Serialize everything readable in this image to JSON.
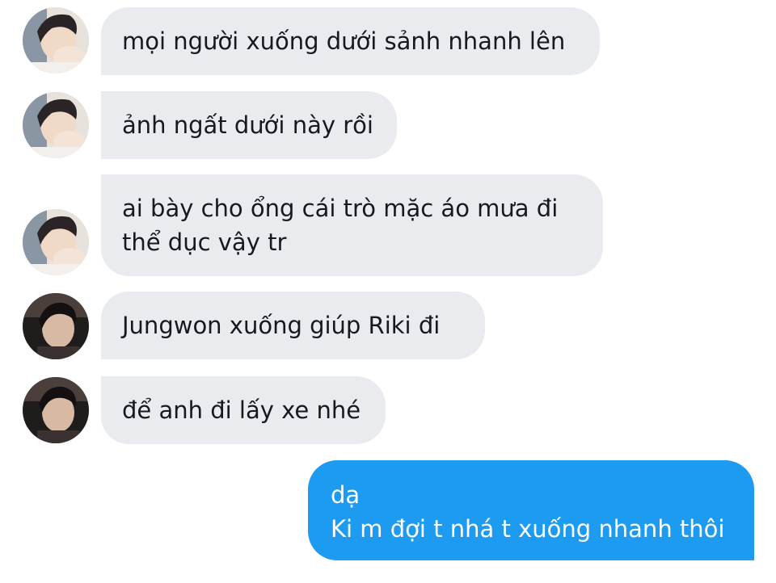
{
  "conversation": {
    "messages": [
      {
        "avatar": "avatar-photo-member-a",
        "text": [
          "mọi người xuống dưới sảnh nhanh lên"
        ]
      },
      {
        "avatar": "avatar-photo-member-a",
        "text": [
          "ảnh ngất dưới này rồi"
        ]
      },
      {
        "avatar": "avatar-photo-member-a",
        "text": [
          "ai bày cho ổng cái trò mặc áo mưa đi",
          "thể dục vậy tr"
        ]
      },
      {
        "avatar": "avatar-photo-member-b",
        "text": [
          "Jungwon xuống giúp Riki đi"
        ]
      },
      {
        "avatar": "avatar-photo-member-b",
        "text": [
          "để anh đi lấy xe nhé"
        ]
      }
    ],
    "sent_message": {
      "text": [
        "dạ",
        "Ki m đợi t nhá t xuống nhanh thôi"
      ]
    }
  },
  "colors": {
    "received_bubble": "#e9ebef",
    "received_text": "#16191d",
    "sent_bubble": "#1d9bf0",
    "sent_text": "#ffffff"
  }
}
